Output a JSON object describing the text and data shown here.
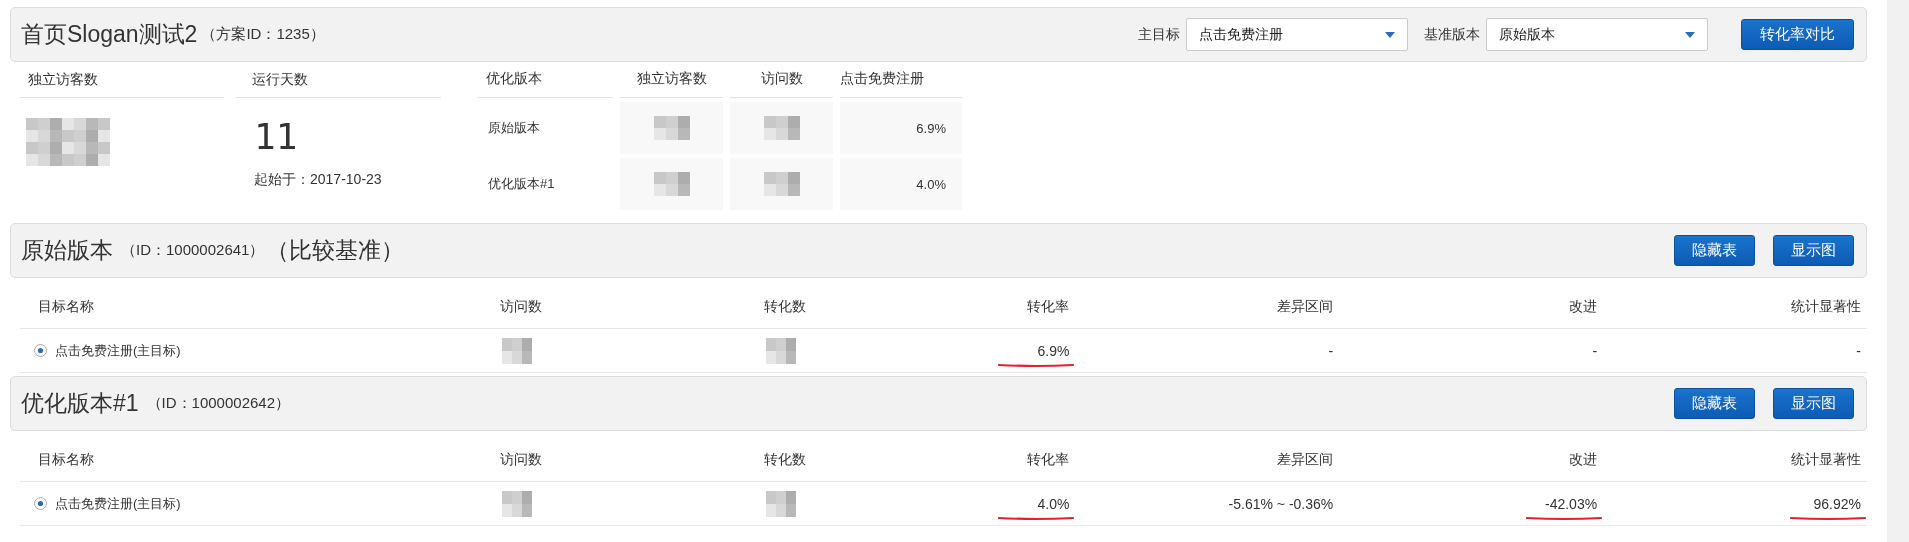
{
  "plan_header": {
    "title": "首页Slogan测试2",
    "subtitle": "（方案ID：1235）",
    "controls": [
      {
        "label": "主目标",
        "value": "点击免费注册"
      },
      {
        "label": "基准版本",
        "value": "原始版本"
      }
    ],
    "button": "转化率对比"
  },
  "summary": {
    "visitors_label": "独立访客数",
    "visitors_value": {
      "kind": "redacted"
    },
    "days_label": "运行天数",
    "days": "11",
    "start": "起始于：2017-10-23",
    "versions_table": {
      "columns": [
        "优化版本",
        "独立访客数",
        "访问数",
        "点击免费注册"
      ],
      "rows": [
        {
          "cells": [
            {
              "kind": "text",
              "text": "原始版本"
            },
            {
              "kind": "redacted"
            },
            {
              "kind": "redacted"
            },
            {
              "kind": "text",
              "text": "6.9%"
            }
          ]
        },
        {
          "cells": [
            {
              "kind": "text",
              "text": "优化版本#1"
            },
            {
              "kind": "redacted"
            },
            {
              "kind": "redacted"
            },
            {
              "kind": "text",
              "text": "4.0%"
            }
          ]
        }
      ]
    }
  },
  "sections": [
    {
      "title": "原始版本",
      "id_text": "（ID：1000002641）",
      "note": "（比较基准）",
      "buttons": [
        "隐藏表",
        "显示图"
      ],
      "columns": [
        "目标名称",
        "访问数",
        "转化数",
        "转化率",
        "差异区间",
        "改进",
        "统计显著性"
      ],
      "rows": [
        {
          "cells": [
            {
              "kind": "goal",
              "text": "点击免费注册(主目标)",
              "selected": true
            },
            {
              "kind": "redacted"
            },
            {
              "kind": "redacted"
            },
            {
              "kind": "text",
              "text": "6.9%",
              "underlined": true
            },
            {
              "kind": "text",
              "text": "-",
              "underlined": false
            },
            {
              "kind": "text",
              "text": "-",
              "underlined": false
            },
            {
              "kind": "text",
              "text": "-",
              "underlined": false
            }
          ]
        }
      ]
    },
    {
      "title": "优化版本#1",
      "id_text": "（ID：1000002642）",
      "buttons": [
        "隐藏表",
        "显示图"
      ],
      "columns": [
        "目标名称",
        "访问数",
        "转化数",
        "转化率",
        "差异区间",
        "改进",
        "统计显著性"
      ],
      "rows": [
        {
          "cells": [
            {
              "kind": "goal",
              "text": "点击免费注册(主目标)",
              "selected": true
            },
            {
              "kind": "redacted"
            },
            {
              "kind": "redacted"
            },
            {
              "kind": "text",
              "text": "4.0%",
              "underlined": true
            },
            {
              "kind": "text",
              "text": "-5.61% ~ -0.36%",
              "underlined": false
            },
            {
              "kind": "text",
              "text": "-42.03%",
              "underlined": true
            },
            {
              "kind": "text",
              "text": "96.92%",
              "underlined": true
            }
          ]
        }
      ]
    }
  ]
}
